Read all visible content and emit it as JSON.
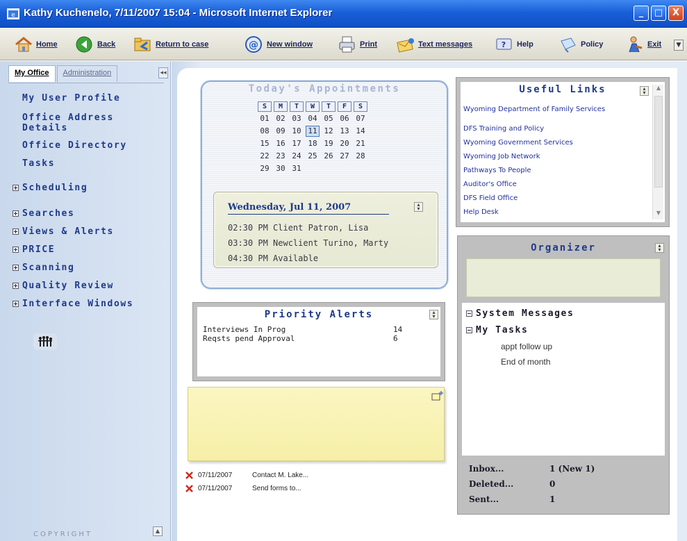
{
  "window": {
    "title": "Kathy Kuchenelo, 7/11/2007 15:04 - Microsoft Internet Explorer",
    "minimize": "_",
    "maximize": "□",
    "close": "X"
  },
  "toolbar": {
    "home": "Home",
    "back": "Back",
    "return_to_case": "Return to case",
    "new_window": "New window",
    "print": "Print",
    "text_messages": "Text messages",
    "help": "Help",
    "policy": "Policy",
    "exit": "Exit",
    "more": "▼"
  },
  "sidebar": {
    "tabs": [
      {
        "label": "My Office",
        "active": true
      },
      {
        "label": "Administration",
        "active": false
      }
    ],
    "collapse": "◂◂",
    "links": [
      "My User Profile",
      "Office Address Details",
      "Office Directory",
      "Tasks"
    ],
    "sections": [
      "Scheduling",
      "Searches",
      "Views & Alerts",
      "PRICE",
      "Scanning",
      "Quality Review",
      "Interface Windows"
    ],
    "copyright": "COPYRIGHT",
    "scroll_up": "▲"
  },
  "appointments": {
    "title": "Today's Appointments",
    "weekdays": [
      "S",
      "M",
      "T",
      "W",
      "T",
      "F",
      "S"
    ],
    "weeks": [
      [
        "",
        "01",
        "02",
        "03",
        "04",
        "05",
        "06",
        "07"
      ],
      [
        "",
        "08",
        "09",
        "10",
        "11",
        "12",
        "13",
        "14"
      ],
      [
        "",
        "15",
        "16",
        "17",
        "18",
        "19",
        "20",
        "21"
      ],
      [
        "",
        "22",
        "23",
        "24",
        "25",
        "26",
        "27",
        "28"
      ],
      [
        "",
        "29",
        "30",
        "31",
        "",
        "",
        "",
        ""
      ]
    ],
    "today": "11",
    "date_heading": "Wednesday, Jul 11, 2007",
    "entries": [
      "02:30 PM Client  Patron, Lisa",
      "03:30 PM Newclient  Turino, Marty",
      "04:30 PM Available"
    ]
  },
  "priority_alerts": {
    "title": "Priority Alerts",
    "rows": [
      {
        "label": "Interviews In Prog",
        "value": "14"
      },
      {
        "label": "Reqsts pend Approval",
        "value": "6"
      }
    ]
  },
  "tasks_list": [
    {
      "date": "07/11/2007",
      "text": "Contact M. Lake..."
    },
    {
      "date": "07/11/2007",
      "text": "Send forms to..."
    }
  ],
  "useful_links": {
    "title": "Useful Links",
    "items": [
      "Wyoming Department of Family Services",
      "DFS Training and Policy",
      "Wyoming Government Services",
      "Wyoming Job Network",
      "Pathways To People",
      "Auditor's Office",
      "DFS Field Office",
      "Help Desk"
    ]
  },
  "organizer": {
    "title": "Organizer",
    "system_messages": "System Messages",
    "my_tasks": "My Tasks",
    "tasks": [
      "appt follow up",
      "End of month"
    ],
    "stats": [
      {
        "label": "Inbox...",
        "value": "1 (New 1)"
      },
      {
        "label": "Deleted...",
        "value": "0"
      },
      {
        "label": "Sent...",
        "value": "1"
      }
    ]
  },
  "colors": {
    "titlebar": "#1a5fd8",
    "nav_text": "#1f3a8a",
    "panel_border": "#bfbfbf",
    "sticky": "#f6efa8"
  }
}
